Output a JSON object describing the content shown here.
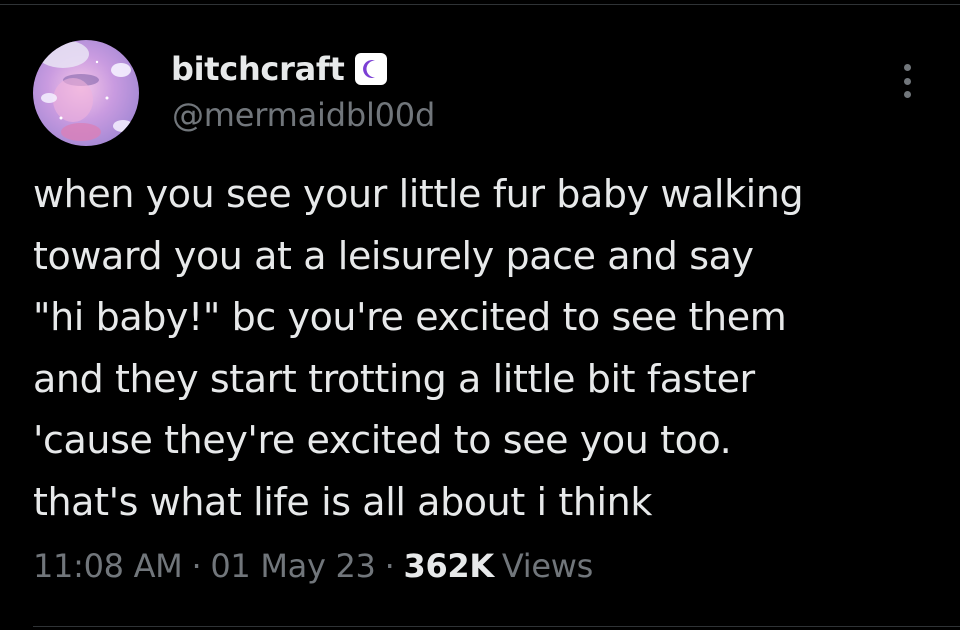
{
  "author": {
    "display_name": "bitchcraft",
    "handle": "@mermaidbl00d",
    "badge_icon": "crescent-moon-emoji",
    "avatar_icon": "profile-photo"
  },
  "tweet": {
    "lines": [
      "when you see your little fur baby walking",
      "toward you at a leisurely pace and say",
      "\"hi baby!\" bc you're excited to see them",
      "and they start trotting a little bit faster",
      "'cause they're excited to see you too.",
      "that's what life is all about i think"
    ]
  },
  "meta": {
    "time": "11:08 AM",
    "separator": "·",
    "date": "01 May 23",
    "views_count": "362K",
    "views_label": "Views"
  },
  "more_icon": "more-vertical-icon",
  "colors": {
    "background": "#000000",
    "primary_text": "#e7e9ea",
    "secondary_text": "#71767b",
    "divider": "#2f3336",
    "badge_moon": "#7b3fd4"
  }
}
